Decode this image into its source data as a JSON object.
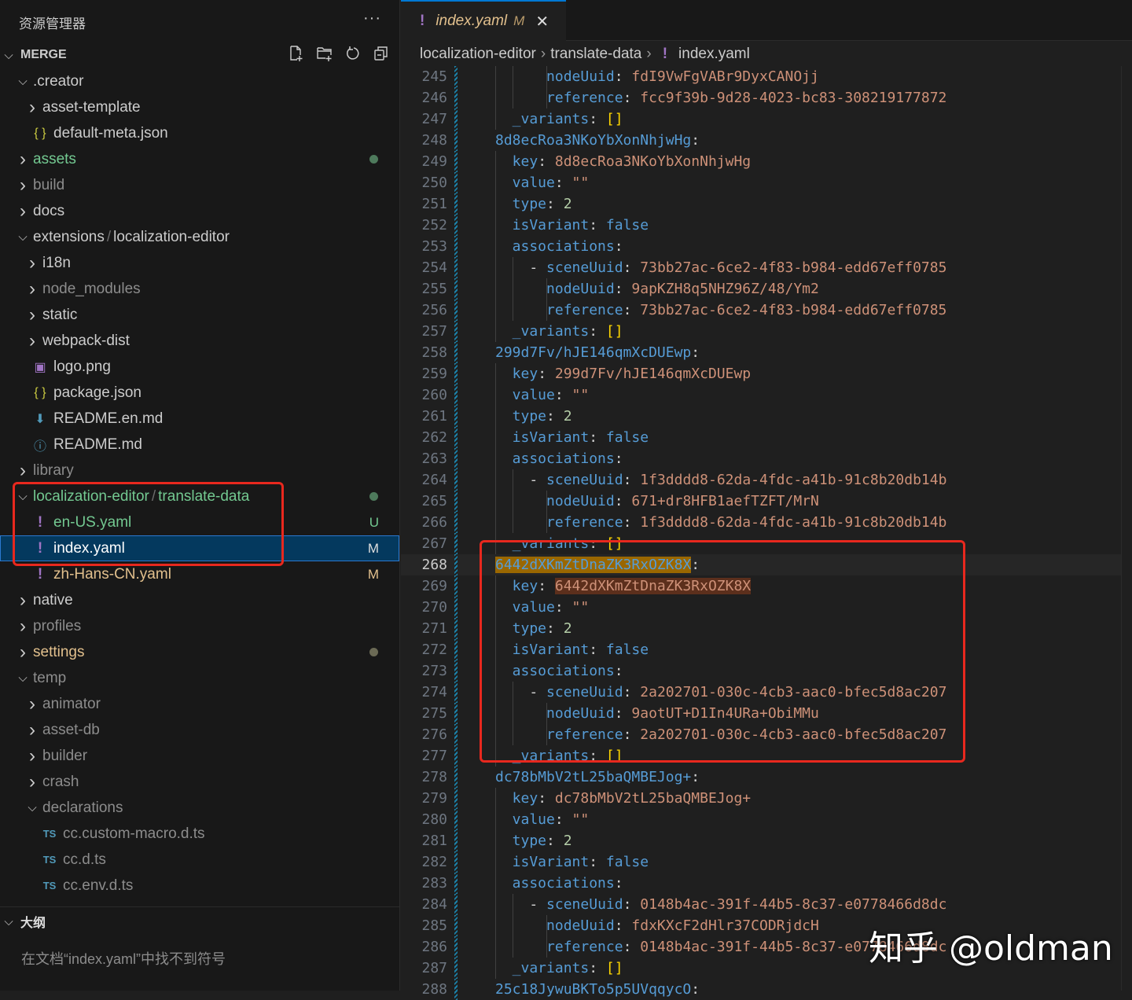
{
  "sidebar": {
    "title": "资源管理器",
    "more": "···",
    "section": "MERGE",
    "tools": [
      "new-file-icon",
      "new-folder-icon",
      "refresh-icon",
      "collapse-all-icon"
    ],
    "tree": [
      {
        "label": ".creator",
        "depth": 1,
        "kind": "open",
        "color": "normal"
      },
      {
        "label": "asset-template",
        "depth": 2,
        "kind": "closed",
        "color": "normal"
      },
      {
        "label": "default-meta.json",
        "depth": 2,
        "kind": "file",
        "icon": "json",
        "color": "normal"
      },
      {
        "label": "assets",
        "depth": 1,
        "kind": "closed",
        "color": "added",
        "dot": "#4e7a5c"
      },
      {
        "label": "build",
        "depth": 1,
        "kind": "closed",
        "color": "dim"
      },
      {
        "label": "docs",
        "depth": 1,
        "kind": "closed",
        "color": "normal"
      },
      {
        "label": "extensions",
        "label2": "localization-editor",
        "depth": 1,
        "kind": "open",
        "color": "normal"
      },
      {
        "label": "i18n",
        "depth": 2,
        "kind": "closed",
        "color": "normal"
      },
      {
        "label": "node_modules",
        "depth": 2,
        "kind": "closed",
        "color": "dim"
      },
      {
        "label": "static",
        "depth": 2,
        "kind": "closed",
        "color": "normal"
      },
      {
        "label": "webpack-dist",
        "depth": 2,
        "kind": "closed",
        "color": "normal"
      },
      {
        "label": "logo.png",
        "depth": 2,
        "kind": "file",
        "icon": "image",
        "color": "normal"
      },
      {
        "label": "package.json",
        "depth": 2,
        "kind": "file",
        "icon": "json",
        "color": "normal"
      },
      {
        "label": "README.en.md",
        "depth": 2,
        "kind": "file",
        "icon": "download",
        "color": "normal"
      },
      {
        "label": "README.md",
        "depth": 2,
        "kind": "file",
        "icon": "info",
        "color": "normal"
      },
      {
        "label": "library",
        "depth": 1,
        "kind": "closed",
        "color": "dim"
      },
      {
        "label": "localization-editor",
        "label2": "translate-data",
        "depth": 1,
        "kind": "open",
        "color": "added",
        "dot": "#4e7a5c"
      },
      {
        "label": "en-US.yaml",
        "depth": 2,
        "kind": "file",
        "icon": "yaml",
        "color": "added",
        "badge": "U"
      },
      {
        "label": "index.yaml",
        "depth": 2,
        "kind": "file",
        "icon": "yaml",
        "color": "white",
        "badge": "M",
        "selected": true
      },
      {
        "label": "zh-Hans-CN.yaml",
        "depth": 2,
        "kind": "file",
        "icon": "yaml",
        "color": "mod",
        "badge": "M"
      },
      {
        "label": "native",
        "depth": 1,
        "kind": "closed",
        "color": "normal"
      },
      {
        "label": "profiles",
        "depth": 1,
        "kind": "closed",
        "color": "dim"
      },
      {
        "label": "settings",
        "depth": 1,
        "kind": "closed",
        "color": "mod",
        "dot": "#6b6a55"
      },
      {
        "label": "temp",
        "depth": 1,
        "kind": "open",
        "color": "dim"
      },
      {
        "label": "animator",
        "depth": 2,
        "kind": "closed",
        "color": "dim"
      },
      {
        "label": "asset-db",
        "depth": 2,
        "kind": "closed",
        "color": "dim"
      },
      {
        "label": "builder",
        "depth": 2,
        "kind": "closed",
        "color": "dim"
      },
      {
        "label": "crash",
        "depth": 2,
        "kind": "closed",
        "color": "dim"
      },
      {
        "label": "declarations",
        "depth": 2,
        "kind": "open",
        "color": "dim"
      },
      {
        "label": "cc.custom-macro.d.ts",
        "depth": 3,
        "kind": "file",
        "icon": "ts",
        "color": "dim"
      },
      {
        "label": "cc.d.ts",
        "depth": 3,
        "kind": "file",
        "icon": "ts",
        "color": "dim"
      },
      {
        "label": "cc.env.d.ts",
        "depth": 3,
        "kind": "file",
        "icon": "ts",
        "color": "dim"
      }
    ],
    "outline": {
      "title": "大纲",
      "message": "在文档“index.yaml”中找不到符号"
    }
  },
  "editor": {
    "tab": {
      "name": "index.yaml",
      "status": "M"
    },
    "breadcrumbs": [
      "localization-editor",
      "translate-data",
      "index.yaml"
    ],
    "current_line": 268,
    "lines": [
      {
        "n": 245,
        "i": 6,
        "k": "nodeUuid",
        "v": "fdI9VwFgVABr9DyxCANOjj",
        "t": "s"
      },
      {
        "n": 246,
        "i": 6,
        "k": "reference",
        "v": "fcc9f39b-9d28-4023-bc83-308219177872",
        "t": "s"
      },
      {
        "n": 247,
        "i": 2,
        "k": "_variants",
        "v": "[]",
        "t": "br"
      },
      {
        "n": 248,
        "i": 0,
        "k": "8d8ecRoa3NKoYbXonNhjwHg"
      },
      {
        "n": 249,
        "i": 2,
        "k": "key",
        "v": "8d8ecRoa3NKoYbXonNhjwHg",
        "t": "s"
      },
      {
        "n": 250,
        "i": 2,
        "k": "value",
        "v": "\"\"",
        "t": "s"
      },
      {
        "n": 251,
        "i": 2,
        "k": "type",
        "v": "2",
        "t": "n"
      },
      {
        "n": 252,
        "i": 2,
        "k": "isVariant",
        "v": "false",
        "t": "b"
      },
      {
        "n": 253,
        "i": 2,
        "k": "associations"
      },
      {
        "n": 254,
        "i": 4,
        "dash": true,
        "k": "sceneUuid",
        "v": "73bb27ac-6ce2-4f83-b984-edd67eff0785",
        "t": "s"
      },
      {
        "n": 255,
        "i": 6,
        "k": "nodeUuid",
        "v": "9apKZH8q5NHZ96Z/48/Ym2",
        "t": "s"
      },
      {
        "n": 256,
        "i": 6,
        "k": "reference",
        "v": "73bb27ac-6ce2-4f83-b984-edd67eff0785",
        "t": "s"
      },
      {
        "n": 257,
        "i": 2,
        "k": "_variants",
        "v": "[]",
        "t": "br"
      },
      {
        "n": 258,
        "i": 0,
        "k": "299d7Fv/hJE146qmXcDUEwp"
      },
      {
        "n": 259,
        "i": 2,
        "k": "key",
        "v": "299d7Fv/hJE146qmXcDUEwp",
        "t": "s"
      },
      {
        "n": 260,
        "i": 2,
        "k": "value",
        "v": "\"\"",
        "t": "s"
      },
      {
        "n": 261,
        "i": 2,
        "k": "type",
        "v": "2",
        "t": "n"
      },
      {
        "n": 262,
        "i": 2,
        "k": "isVariant",
        "v": "false",
        "t": "b"
      },
      {
        "n": 263,
        "i": 2,
        "k": "associations"
      },
      {
        "n": 264,
        "i": 4,
        "dash": true,
        "k": "sceneUuid",
        "v": "1f3dddd8-62da-4fdc-a41b-91c8b20db14b",
        "t": "s"
      },
      {
        "n": 265,
        "i": 6,
        "k": "nodeUuid",
        "v": "671+dr8HFB1aefTZFT/MrN",
        "t": "s"
      },
      {
        "n": 266,
        "i": 6,
        "k": "reference",
        "v": "1f3dddd8-62da-4fdc-a41b-91c8b20db14b",
        "t": "s"
      },
      {
        "n": 267,
        "i": 2,
        "k": "_variants",
        "v": "[]",
        "t": "br"
      },
      {
        "n": 268,
        "i": 0,
        "k": "6442dXKmZtDnaZK3RxOZK8X",
        "hlk": true
      },
      {
        "n": 269,
        "i": 2,
        "k": "key",
        "v": "6442dXKmZtDnaZK3RxOZK8X",
        "t": "s",
        "hlv": true
      },
      {
        "n": 270,
        "i": 2,
        "k": "value",
        "v": "\"\"",
        "t": "s"
      },
      {
        "n": 271,
        "i": 2,
        "k": "type",
        "v": "2",
        "t": "n"
      },
      {
        "n": 272,
        "i": 2,
        "k": "isVariant",
        "v": "false",
        "t": "b"
      },
      {
        "n": 273,
        "i": 2,
        "k": "associations"
      },
      {
        "n": 274,
        "i": 4,
        "dash": true,
        "k": "sceneUuid",
        "v": "2a202701-030c-4cb3-aac0-bfec5d8ac207",
        "t": "s"
      },
      {
        "n": 275,
        "i": 6,
        "k": "nodeUuid",
        "v": "9aotUT+D1In4URa+ObiMMu",
        "t": "s"
      },
      {
        "n": 276,
        "i": 6,
        "k": "reference",
        "v": "2a202701-030c-4cb3-aac0-bfec5d8ac207",
        "t": "s"
      },
      {
        "n": 277,
        "i": 2,
        "k": "_variants",
        "v": "[]",
        "t": "br"
      },
      {
        "n": 278,
        "i": 0,
        "k": "dc78bMbV2tL25baQMBEJog+"
      },
      {
        "n": 279,
        "i": 2,
        "k": "key",
        "v": "dc78bMbV2tL25baQMBEJog+",
        "t": "s"
      },
      {
        "n": 280,
        "i": 2,
        "k": "value",
        "v": "\"\"",
        "t": "s"
      },
      {
        "n": 281,
        "i": 2,
        "k": "type",
        "v": "2",
        "t": "n"
      },
      {
        "n": 282,
        "i": 2,
        "k": "isVariant",
        "v": "false",
        "t": "b"
      },
      {
        "n": 283,
        "i": 2,
        "k": "associations"
      },
      {
        "n": 284,
        "i": 4,
        "dash": true,
        "k": "sceneUuid",
        "v": "0148b4ac-391f-44b5-8c37-e0778466d8dc",
        "t": "s"
      },
      {
        "n": 285,
        "i": 6,
        "k": "nodeUuid",
        "v": "fdxKXcF2dHlr37CODRjdcH",
        "t": "s"
      },
      {
        "n": 286,
        "i": 6,
        "k": "reference",
        "v": "0148b4ac-391f-44b5-8c37-e0778466d8dc",
        "t": "s"
      },
      {
        "n": 287,
        "i": 2,
        "k": "_variants",
        "v": "[]",
        "t": "br"
      },
      {
        "n": 288,
        "i": 0,
        "k": "25c18JywuBKTo5p5UVqqycO"
      }
    ]
  },
  "watermark": "知乎 @oldman"
}
